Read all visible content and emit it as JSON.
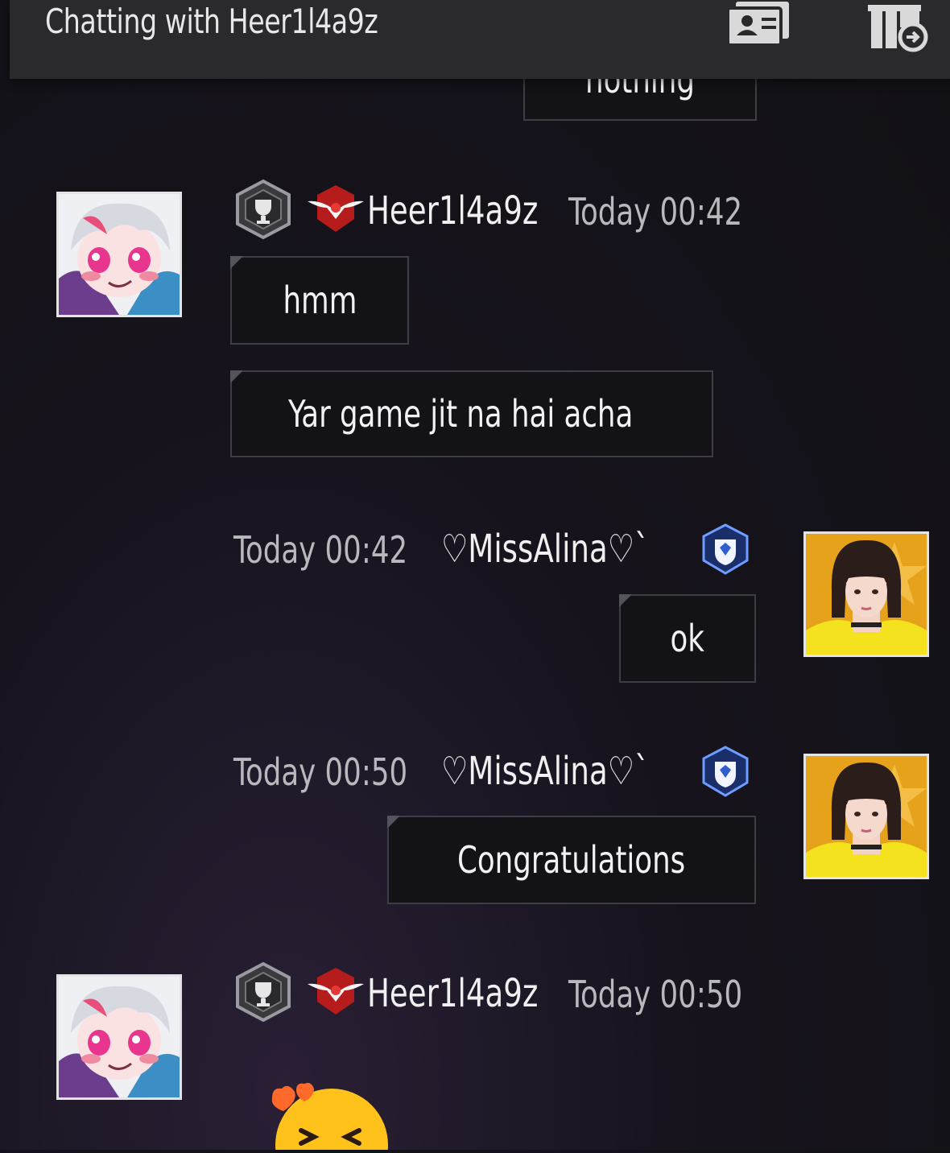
{
  "header": {
    "title": "Chatting with Heer1l4a9z",
    "profile_icon": "profile-card-icon",
    "gift_icon": "gift-send-icon"
  },
  "messages": {
    "partial_prev": "nothing",
    "m1": {
      "sender": "Heer1l4a9z",
      "time": "Today 00:42",
      "bubbles": [
        "hmm",
        "Yar game jit na hai acha"
      ]
    },
    "m2": {
      "sender": "♡MissAlina♡`",
      "time": "Today 00:42",
      "bubbles": [
        "ok"
      ]
    },
    "m3": {
      "sender": "♡MissAlina♡`",
      "time": "Today 00:50",
      "bubbles": [
        "Congratulations"
      ]
    },
    "m4": {
      "sender": "Heer1l4a9z",
      "time": "Today 00:50",
      "sticker": "laughing-emoji-sticker"
    }
  },
  "colors": {
    "background": "#16131c",
    "header": "#2a2a2d",
    "bubble": "#131217",
    "bubble_border": "#3e3d44",
    "guild_red": "#c62828",
    "rank_blue": "#2f5fcf"
  }
}
